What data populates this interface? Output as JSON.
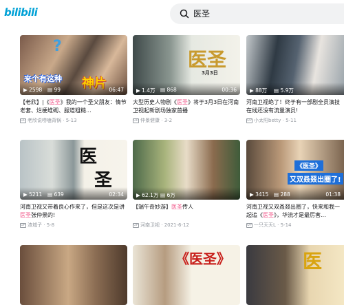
{
  "app": {
    "logo": "bilibili"
  },
  "search": {
    "query": "医圣"
  },
  "cards": [
    {
      "stats": {
        "plays": "2598",
        "danmaku": "99",
        "duration": "06:47"
      },
      "title_pre": "【老欣】|《",
      "title_hl": "医圣",
      "title_post": "》我的一个圣父朋友：情节老套、烂梗堆砌、服道粗糙...",
      "uploader": "老欣说唠嗑背锅",
      "date": "5-13",
      "overlay": [
        "来个有这种",
        "神片"
      ]
    },
    {
      "stats": {
        "plays": "1.4万",
        "danmaku": "868",
        "duration": "00:36"
      },
      "title_pre": "大型历史人物剧《",
      "title_hl": "医圣",
      "title_post": "》将于3月3日在河南卫视起新剧场独家首播",
      "uploader": "仲景健康",
      "date": "3-2",
      "overlay": [
        "医圣",
        "3月3日"
      ]
    },
    {
      "stats": {
        "plays": "88万",
        "danmaku": "5.9万",
        "duration": ""
      },
      "title_pre": "河南卫视绝了！终于有一部剧全员演技在线还没有流量演员!",
      "title_hl": "",
      "title_post": "",
      "uploader": "小太阳betty",
      "date": "5-11",
      "overlay": []
    },
    {
      "stats": {
        "plays": "5211",
        "danmaku": "639",
        "duration": "02:34"
      },
      "title_pre": "河南卫视又带着良心作来了，但是这次是讲",
      "title_hl": "医圣",
      "title_post": "张仲景的!",
      "uploader": "渣城子",
      "date": "5-8",
      "overlay": [
        "医",
        "圣"
      ]
    },
    {
      "stats": {
        "plays": "62.1万",
        "danmaku": "6万",
        "duration": ""
      },
      "title_pre": "【端午奇妙游】",
      "title_hl": "医圣",
      "title_post": "传人",
      "uploader": "河南卫视",
      "date": "2021-6-12",
      "overlay": []
    },
    {
      "stats": {
        "plays": "3415",
        "danmaku": "288",
        "duration": "01:38"
      },
      "title_pre": "河南卫视又双叒叕出圈了，快来和我一起追《",
      "title_hl": "医圣",
      "title_post": "》，华流才是最厉害...",
      "uploader": "一只天天L",
      "date": "5-14",
      "overlay": [
        "《医圣》",
        "又双叒叕出圈了!"
      ]
    },
    {
      "stats": {
        "plays": "",
        "danmaku": "",
        "duration": ""
      },
      "title_pre": "",
      "title_hl": "",
      "title_post": "",
      "uploader": "",
      "date": "",
      "overlay": []
    },
    {
      "stats": {
        "plays": "",
        "danmaku": "",
        "duration": ""
      },
      "title_pre": "",
      "title_hl": "",
      "title_post": "",
      "uploader": "",
      "date": "",
      "overlay": [
        "《医圣》"
      ]
    },
    {
      "stats": {
        "plays": "",
        "danmaku": "",
        "duration": ""
      },
      "title_pre": "",
      "title_hl": "",
      "title_post": "",
      "uploader": "",
      "date": "",
      "overlay": [
        "医"
      ]
    }
  ]
}
